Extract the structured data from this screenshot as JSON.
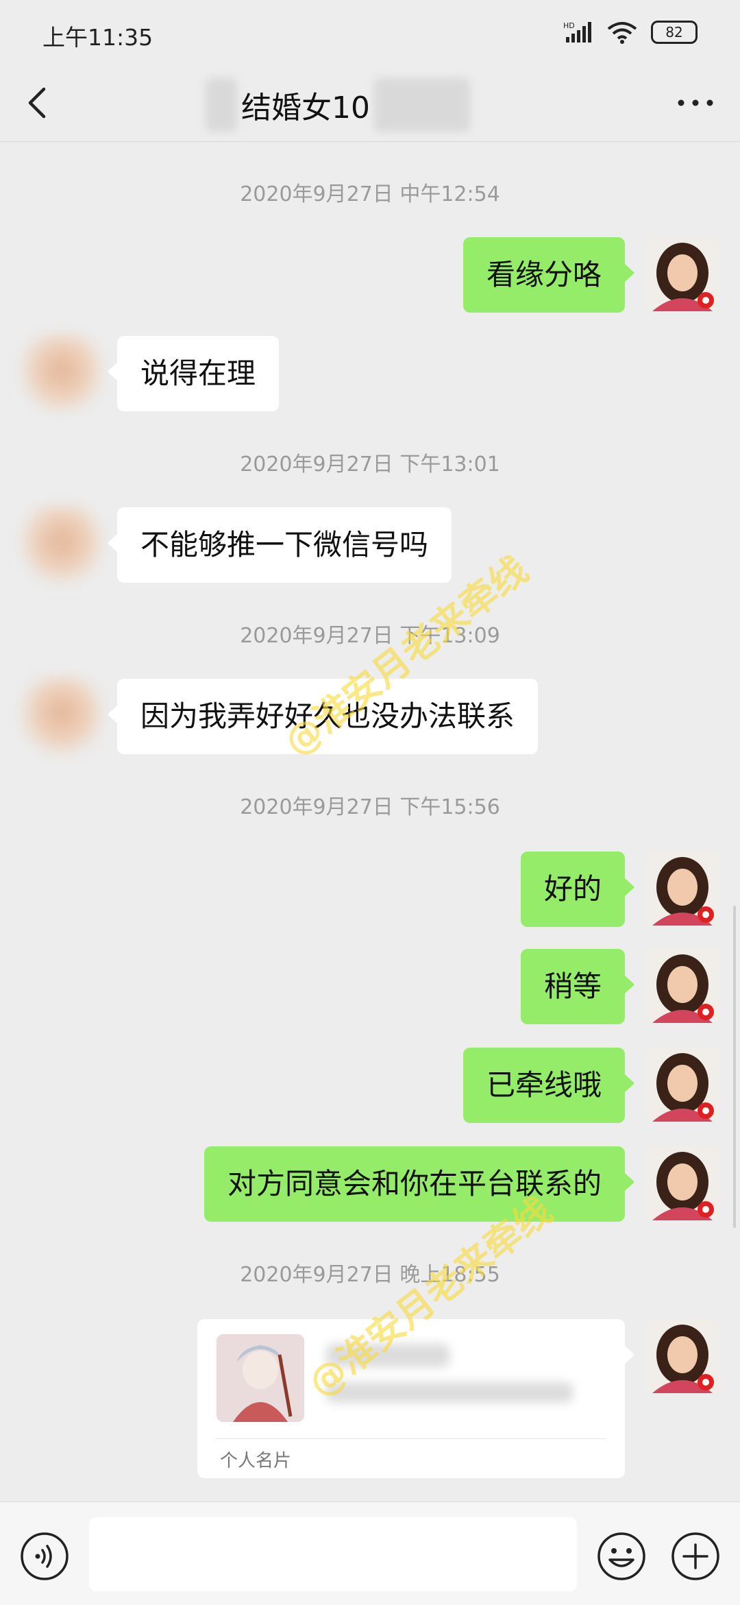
{
  "status_bar": {
    "time": "上午11:35",
    "network": "HD",
    "battery": "82"
  },
  "header": {
    "title": "结婚女10",
    "back_icon": "chevron-left-icon",
    "more_icon": "more-dots-icon"
  },
  "messages": [
    {
      "kind": "timestamp",
      "text": "2020年9月27日 中午12:54"
    },
    {
      "kind": "me",
      "text": "看缘分咯"
    },
    {
      "kind": "other",
      "text": "说得在理"
    },
    {
      "kind": "timestamp",
      "text": "2020年9月27日 下午13:01"
    },
    {
      "kind": "other",
      "text": "不能够推一下微信号吗"
    },
    {
      "kind": "timestamp",
      "text": "2020年9月27日 下午13:09"
    },
    {
      "kind": "other",
      "text": "因为我弄好好久也没办法联系"
    },
    {
      "kind": "timestamp",
      "text": "2020年9月27日 下午15:56"
    },
    {
      "kind": "me",
      "text": "好的"
    },
    {
      "kind": "me",
      "text": "稍等"
    },
    {
      "kind": "me",
      "text": "已牵线哦"
    },
    {
      "kind": "me",
      "text": "对方同意会和你在平台联系的"
    },
    {
      "kind": "timestamp",
      "text": "2020年9月27日 晚上18:55"
    },
    {
      "kind": "me-card",
      "label": "个人名片"
    }
  ],
  "watermark": "@淮安月老来牵线",
  "input_bar": {
    "voice_icon": "voice-icon",
    "emoji_icon": "emoji-icon",
    "plus_icon": "plus-icon",
    "placeholder": ""
  },
  "colors": {
    "background": "#ededed",
    "my_bubble": "#95ec69",
    "other_bubble": "#ffffff",
    "timestamp": "#9a9a9a"
  }
}
